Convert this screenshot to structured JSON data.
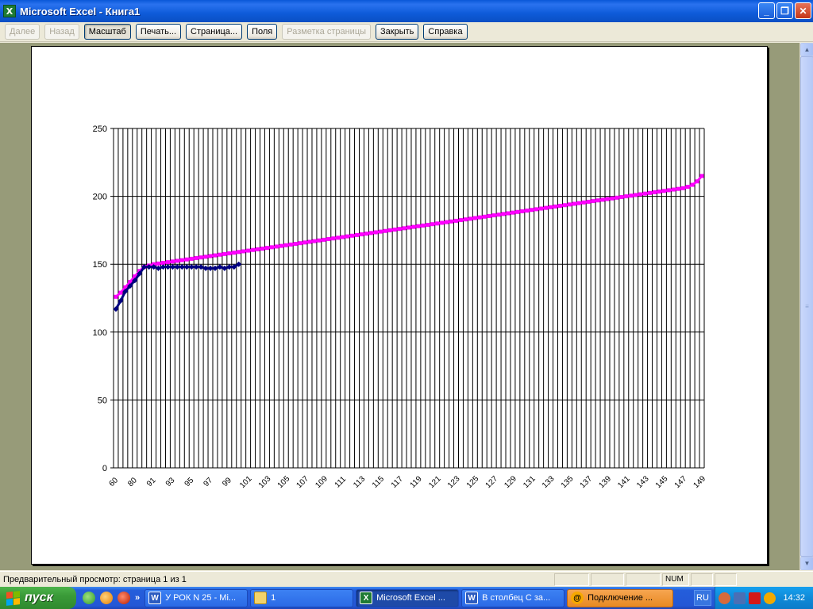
{
  "window": {
    "title": "Microsoft Excel - Книга1",
    "minimize_glyph": "_",
    "maximize_glyph": "❐",
    "close_glyph": "✕"
  },
  "toolbar": {
    "buttons": [
      {
        "label": "Далее",
        "state": "disabled"
      },
      {
        "label": "Назад",
        "state": "disabled"
      },
      {
        "label": "Масштаб",
        "state": "pressed"
      },
      {
        "label": "Печать...",
        "state": "normal"
      },
      {
        "label": "Страница...",
        "state": "normal"
      },
      {
        "label": "Поля",
        "state": "normal"
      },
      {
        "label": "Разметка страницы",
        "state": "disabled"
      },
      {
        "label": "Закрыть",
        "state": "normal"
      },
      {
        "label": "Справка",
        "state": "normal"
      }
    ]
  },
  "status": {
    "text": "Предварительный просмотр: страница 1 из 1",
    "num": "NUM"
  },
  "taskbar": {
    "start_label": "пуск",
    "quick_chevron": "»",
    "tasks": [
      {
        "label": "У РОК N 25 - Mi...",
        "icon": "W",
        "state": "normal"
      },
      {
        "label": "1",
        "icon": "folder",
        "state": "normal"
      },
      {
        "label": "Microsoft Excel ...",
        "icon": "X",
        "state": "active"
      },
      {
        "label": "В столбец С за...",
        "icon": "W",
        "state": "normal"
      },
      {
        "label": "Подключение ...",
        "icon": "@",
        "state": "flash"
      }
    ],
    "lang": "RU",
    "clock": "14:32"
  },
  "colors": {
    "series_magenta": "#ff00ff",
    "series_navy": "#000080",
    "preview_bg": "#979b79"
  },
  "chart_data": {
    "type": "line",
    "title": "",
    "xlabel": "",
    "ylabel": "",
    "ylim": [
      0,
      250
    ],
    "yticks": [
      0,
      50,
      100,
      150,
      200,
      250
    ],
    "x_tick_labels": [
      "60",
      "80",
      "91",
      "93",
      "95",
      "97",
      "99",
      "101",
      "103",
      "105",
      "107",
      "109",
      "111",
      "113",
      "115",
      "117",
      "119",
      "121",
      "123",
      "125",
      "127",
      "129",
      "131",
      "133",
      "135",
      "137",
      "139",
      "141",
      "143",
      "145",
      "147",
      "149"
    ],
    "grid": true,
    "legend": "none",
    "series": [
      {
        "color": "#ff00ff",
        "marker": "square",
        "values": [
          126,
          129,
          133,
          137,
          141,
          145,
          148,
          149,
          150,
          150.5,
          151,
          151.5,
          152,
          152.5,
          153,
          153.5,
          154,
          154.5,
          155,
          155.5,
          156,
          156.5,
          157,
          157.5,
          158,
          158.5,
          159,
          159.5,
          160,
          160.5,
          161,
          161.5,
          162,
          162.5,
          163,
          163.5,
          164,
          164.5,
          165,
          165.5,
          166,
          166.5,
          167,
          167.5,
          168,
          168.5,
          169,
          169.5,
          170,
          170.5,
          171,
          171.5,
          172,
          172.5,
          173,
          173.5,
          174,
          174.5,
          175,
          175.5,
          176,
          176.5,
          177,
          177.5,
          178,
          178.5,
          179,
          179.5,
          180,
          180.5,
          181,
          181.5,
          182,
          182.5,
          183,
          183.5,
          184,
          184.5,
          185,
          185.5,
          186,
          186.5,
          187,
          187.5,
          188,
          188.5,
          189,
          189.5,
          190,
          190.5,
          191,
          191.5,
          192,
          192.5,
          193,
          193.5,
          194,
          194.5,
          195,
          195.5,
          196,
          196.5,
          197,
          197.5,
          198,
          198.5,
          199,
          199.5,
          200,
          200.5,
          201,
          201.5,
          202,
          202.5,
          203,
          203.5,
          204,
          204.5,
          205,
          205.5,
          206,
          207,
          208.5,
          211,
          215
        ]
      },
      {
        "color": "#000080",
        "marker": "diamond",
        "values": [
          117,
          123,
          130,
          134,
          138,
          143,
          148,
          148,
          148,
          147,
          148,
          148,
          148,
          148,
          148,
          148,
          148,
          148,
          148,
          147,
          147,
          147,
          148,
          147,
          148,
          148,
          150
        ]
      }
    ]
  }
}
